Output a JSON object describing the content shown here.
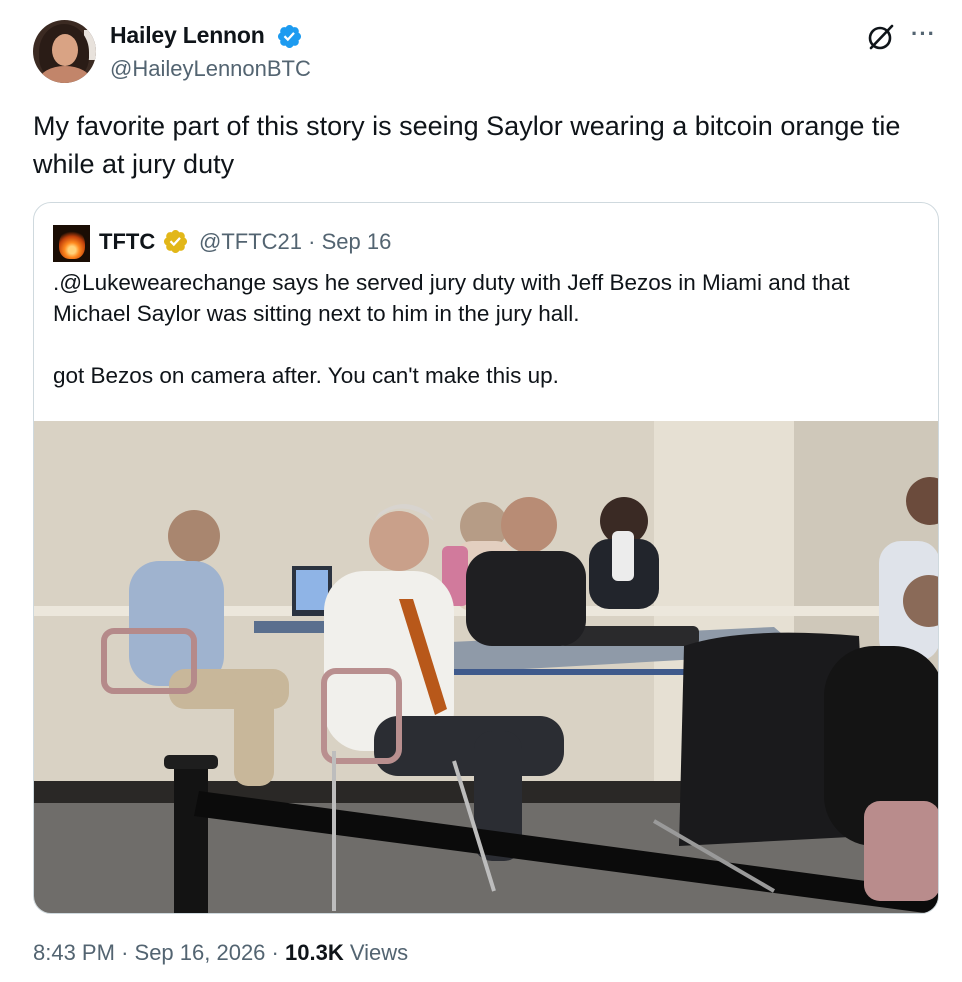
{
  "author": {
    "name": "Hailey Lennon",
    "handle": "@HaileyLennonBTC",
    "verified_color": "#1d9bf0"
  },
  "tweet": {
    "text": "My favorite part of this story is seeing Saylor wearing a bitcoin orange tie while at jury duty"
  },
  "quoted": {
    "name": "TFTC",
    "handle": "@TFTC21",
    "separator": "·",
    "date": "Sep 16",
    "badge_color": "#e2b719",
    "text": ".@Lukewearechange says he served jury duty with Jeff Bezos in Miami and that Michael Saylor was sitting next to him in the jury hall.\n\ngot Bezos on camera after. You can't make this up."
  },
  "footer": {
    "time": "8:43 PM",
    "sep1": "·",
    "date": "Sep 16, 2026",
    "sep2": "·",
    "views_count": "10.3K",
    "views_label": "Views"
  },
  "icons": {
    "grok": "grok-icon",
    "more": "more-icon",
    "more_glyph": "···"
  }
}
